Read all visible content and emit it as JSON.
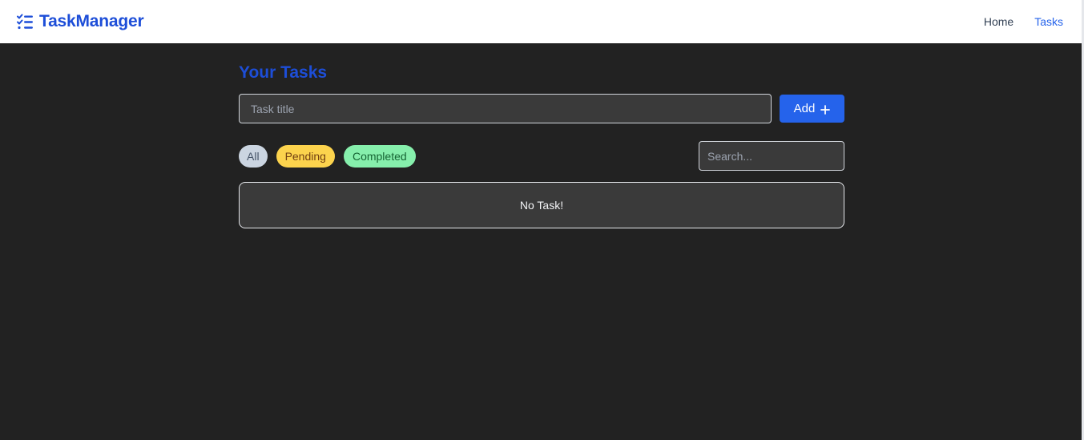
{
  "navbar": {
    "brand": "TaskManager",
    "brand_icon": "task-list-icon",
    "links": [
      {
        "label": "Home",
        "active": false
      },
      {
        "label": "Tasks",
        "active": true
      }
    ]
  },
  "main": {
    "title": "Your Tasks",
    "task_input": {
      "placeholder": "Task title",
      "value": ""
    },
    "add_button": {
      "label": "Add",
      "icon": "plus-icon"
    },
    "filters": [
      {
        "label": "All",
        "color": "#cbd5e1"
      },
      {
        "label": "Pending",
        "color": "#fcd34d"
      },
      {
        "label": "Completed",
        "color": "#86efac"
      }
    ],
    "search": {
      "placeholder": "Search...",
      "value": ""
    },
    "empty_message": "No Task!"
  },
  "colors": {
    "accent": "#1d4ed8",
    "button": "#2563eb",
    "background": "#222222",
    "surface": "#3a3a3a"
  }
}
